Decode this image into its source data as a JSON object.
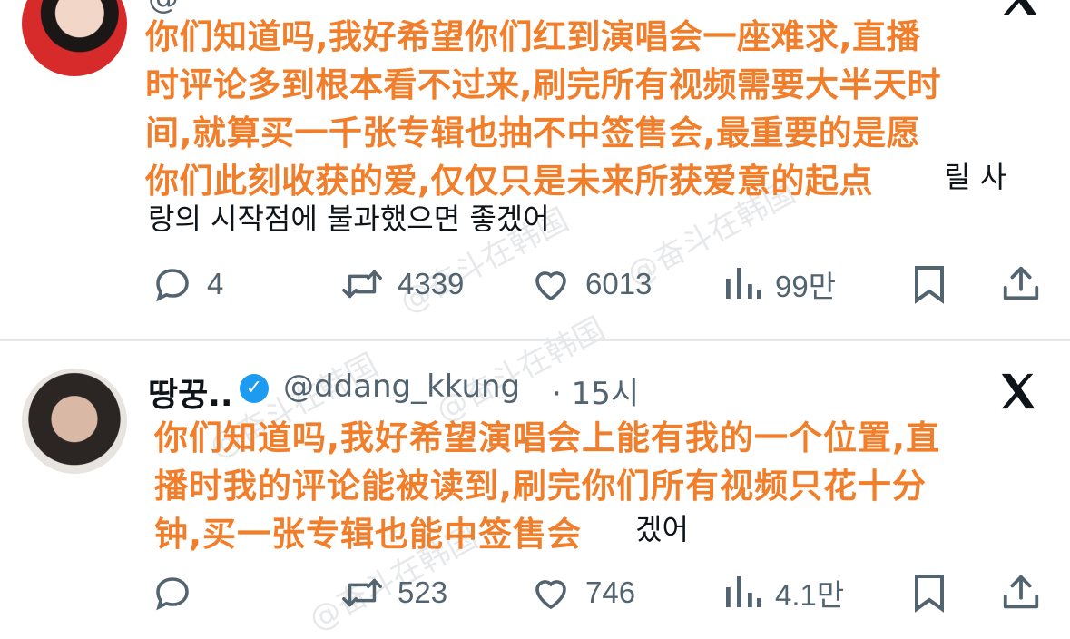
{
  "tweets": [
    {
      "handle_partial": "@",
      "overlay_lines": [
        "你们知道吗,我好希望你们红到演唱会一座难求,直播",
        "时评论多到根本看不过来,刷完所有视频需要大半天时",
        "间,就算买一千张专辑也抽不中签售会,最重要的是愿",
        "你们此刻收获的爱,仅仅只是未来所获爱意的起点"
      ],
      "korean_tail": [
        "릴 사",
        "랑의 시작점에 불과했으면 좋겠어"
      ],
      "actions": {
        "replies": "4",
        "retweets": "4339",
        "likes": "6013",
        "views": "99만"
      }
    },
    {
      "name": "땅꿍..",
      "handle": "@ddang_kkung",
      "time": "· 15시",
      "overlay_lines": [
        "你们知道吗,我好希望演唱会上能有我的一个位置,直",
        "播时我的评论能被读到,刷完你们所有视频只花十分",
        "钟,买一张专辑也能中签售会"
      ],
      "korean_tail": [
        "겠어"
      ],
      "actions": {
        "replies": "",
        "retweets": "523",
        "likes": "746",
        "views": "4.1만"
      }
    }
  ],
  "watermark": "@奋斗在韩国",
  "icons": [
    "reply-icon",
    "retweet-icon",
    "like-icon",
    "views-icon",
    "bookmark-icon",
    "share-icon",
    "x-logo-icon",
    "verified-badge-icon"
  ],
  "colors": {
    "overlay_text": "#f07e2a",
    "meta_gray": "#536471",
    "verified_blue": "#1d9bf0"
  }
}
